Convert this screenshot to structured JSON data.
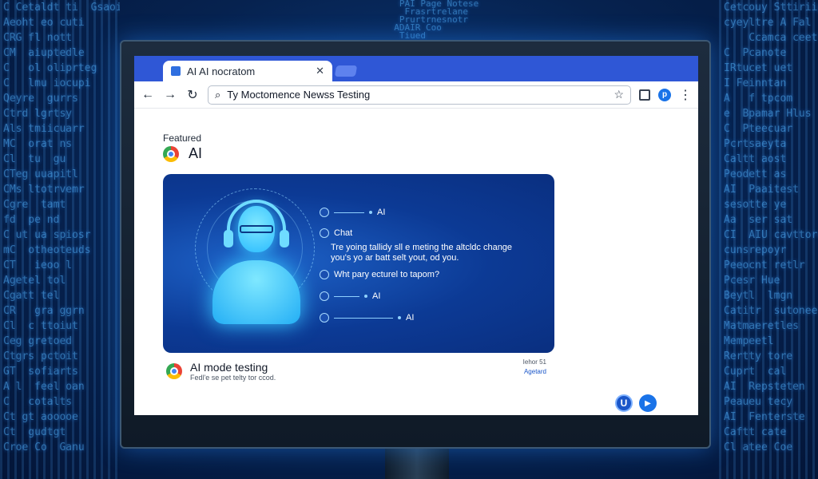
{
  "browser": {
    "tab_title": "AI AI nocratom",
    "tab_close": "✕",
    "back": "←",
    "forward": "→",
    "reload": "↻",
    "search_icon": "⌕",
    "address": "Ty Moctomence Newss Testing",
    "star": "☆",
    "profile_initial": "p",
    "menu": "⋮"
  },
  "page": {
    "featured_label": "Featured",
    "featured_title": "AI"
  },
  "hero": {
    "items": [
      {
        "label": "AI"
      },
      {
        "label": "Chat"
      },
      {
        "label": "Wht pary ecturel to tapom?"
      },
      {
        "label": "AI"
      },
      {
        "label": "AI"
      }
    ],
    "chat_body": "Tre yoing tallidy sll e meting the altcldc change you's yo ar batt selt yout, od you."
  },
  "result": {
    "title": "AI mode testing",
    "snippet": "Fedl'e se pet telty tor ccod.",
    "meta_date": "Iehor 51",
    "meta_author": "Agetard"
  },
  "fabs": {
    "u_label": "U",
    "play_label": "▶"
  },
  "background": {
    "left_code": "C Cetaldt ti  Gsaoiuh\nAeoht eo cuti\nCRG fl nott\nCM  aiuptedle\nC   ol oliprteg\nC   lmu iocupi\nQeyre  gurrs\nCtrd lgrtsy\nAls tmiicuarr\nMC  orat ns\nCl  tu  gu\nCTeg uuapitl\nCMs ltotrvemr\nCgre  tamt\nfd  pe nd\nC ut ua spiosr\nmC  otheoteuds\nCT   ieoo l\nAgetel tol\nCgatt tel\nCR   gra ggrn\nCl  c ttoiut\nCeg gretoed\nCtgrs pctoit\nGT  sofiarts\nA l  feel oan\nC   cotalts\nCt gt aooooe\nCt  gudtgt\nCroe Co  Ganu",
    "right_code": "Cetcouy Sttiriipp\ncyeyltre A Fal\n    Ccamca ceetle\nC  Pcanote\nIRtucet uet\nI Feinntan\nA   f tpcom\ne  Bpamar Hlus\nC  Pteecuar\nPcrtsaeyta\nCaltt aost\nPeodett as\nAI  Paaitest\nsesotte ye\nAa  ser sat\nCI  AIU cavttore\ncunsrepoyr\nPeeocnt retlr\nPcesr Hue\nBeytl  lmgn\nCatitr  sutonee\nMatmaeretles\nMempeetl\nRertty tore\nCuprt  cal\nAI  Repsteten\nPeaueu tecy\nAI  Fenterste\nCaftt cate\nCl atee Coe",
    "top_code": "   PAI Page Notese\n    Frasrtrelane\n   Prurtrnesnotr\n  ADAIR Coo\n   Tiued"
  }
}
